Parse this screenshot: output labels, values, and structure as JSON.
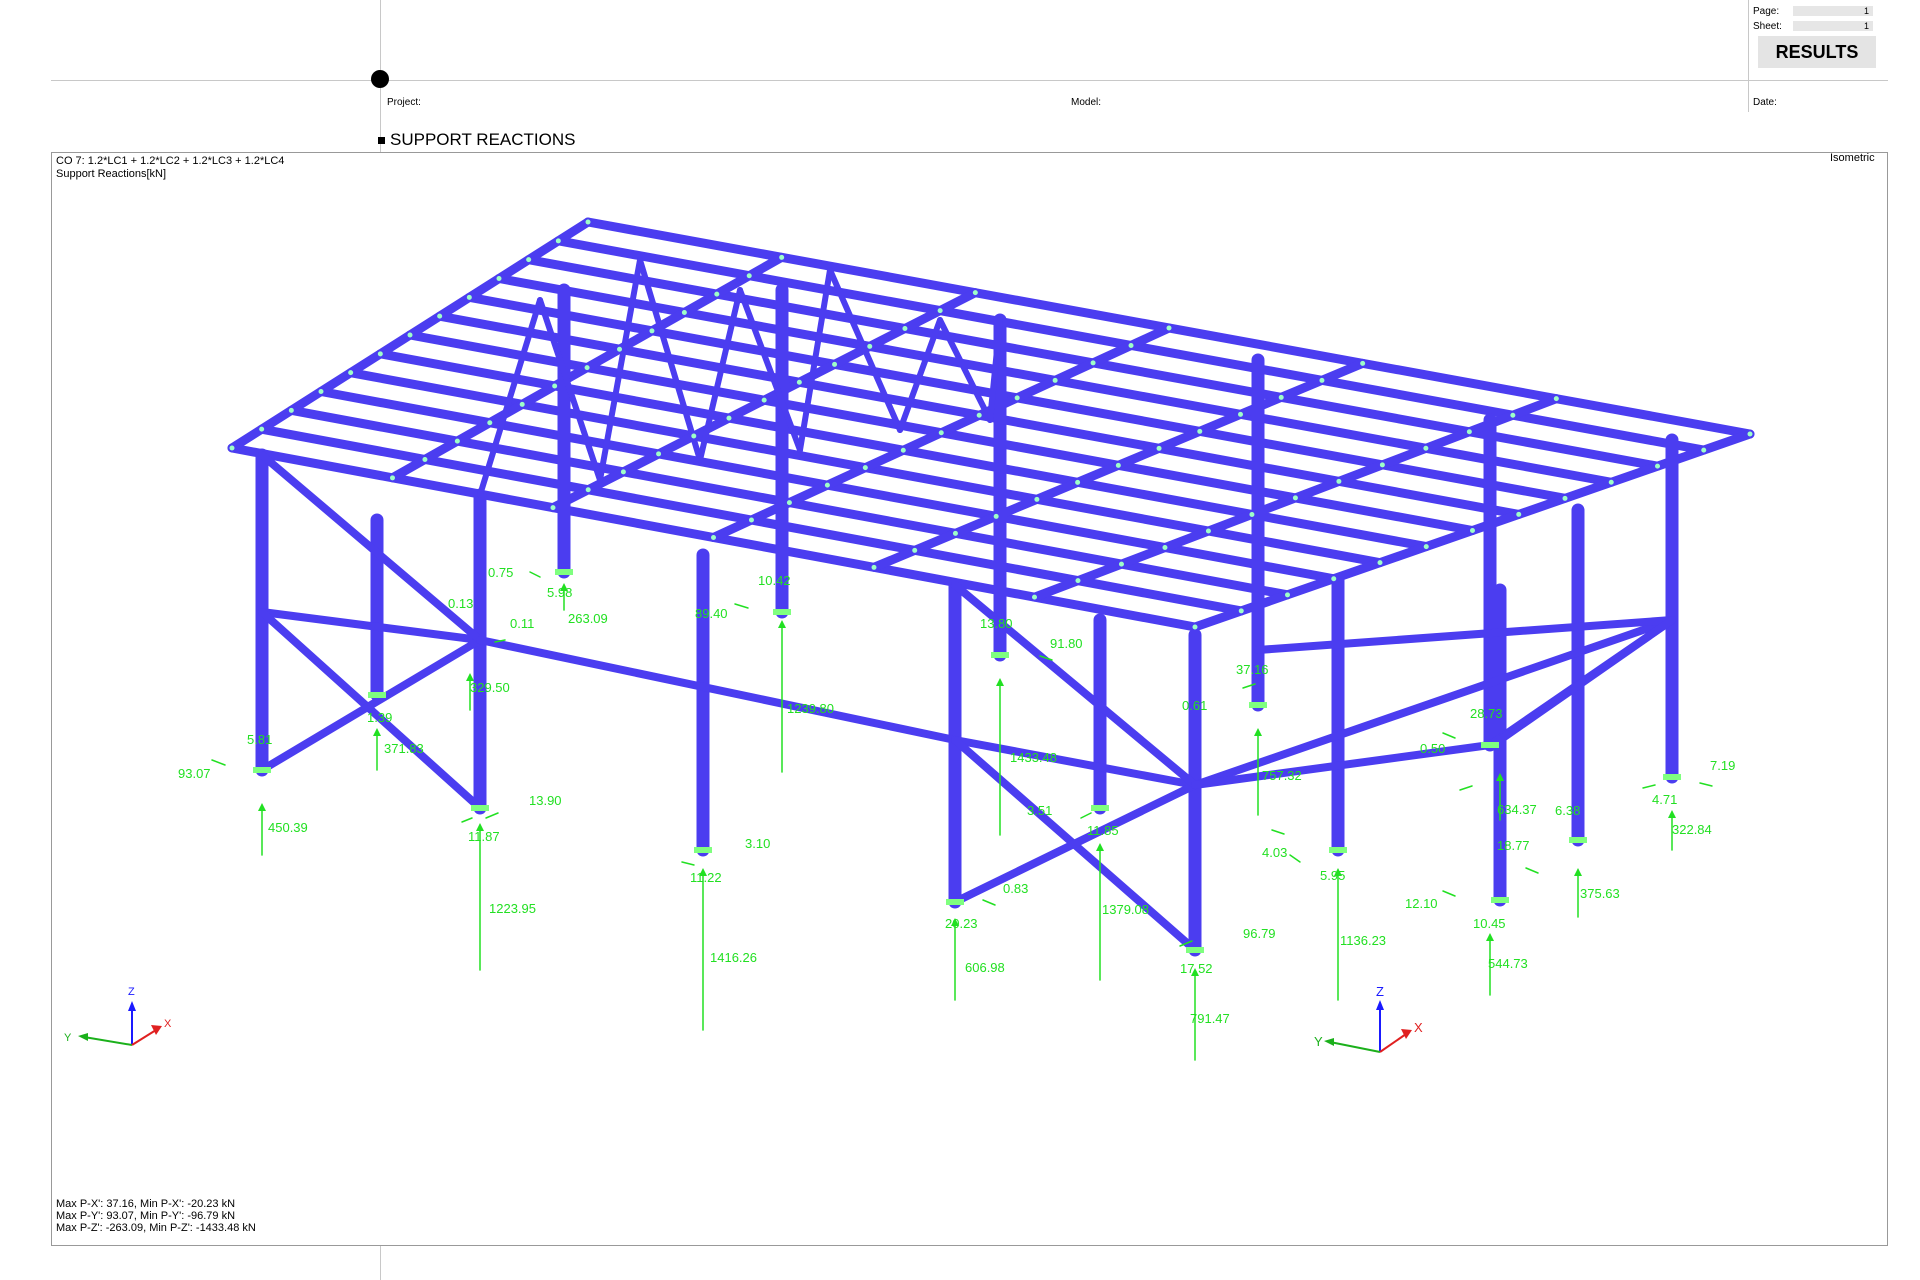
{
  "header": {
    "project_label": "Project:",
    "model_label": "Model:",
    "date_label": "Date:",
    "page_label": "Page:",
    "page_value": "1",
    "sheet_label": "Sheet:",
    "sheet_value": "1",
    "results_button": "RESULTS"
  },
  "section": {
    "title": "SUPPORT REACTIONS"
  },
  "view": {
    "load_combo": "CO 7: 1.2*LC1 + 1.2*LC2 + 1.2*LC3 + 1.2*LC4",
    "result_type": "Support Reactions[kN]",
    "projection": "Isometric"
  },
  "summary": [
    "Max P-X': 37.16, Min P-X': -20.23 kN",
    "Max P-Y': 93.07, Min P-Y': -96.79 kN",
    "Max P-Z': -263.09, Min P-Z': -1433.48 kN"
  ],
  "axis_labels": {
    "x": "X",
    "y": "Y",
    "z": "Z"
  },
  "colors": {
    "member": "#4b3df0",
    "member_edge": "#3529c8",
    "reaction": "#22e022",
    "support": "#7fff7f"
  },
  "reaction_labels": [
    "0.75",
    "5.98",
    "263.09",
    "0.13",
    "0.11",
    "329.50",
    "10.42",
    "89.40",
    "1239.80",
    "5.81",
    "93.07",
    "450.39",
    "1.39",
    "371.83",
    "13.90",
    "11.87",
    "1223.95",
    "3.10",
    "11.22",
    "1416.26",
    "13.80",
    "91.80",
    "1433.48",
    "37.16",
    "0.61",
    "757.32",
    "3.51",
    "11.85",
    "1379.08",
    "0.83",
    "20.23",
    "606.98",
    "96.79",
    "17.52",
    "791.47",
    "4.03",
    "5.95",
    "1136.23",
    "28.73",
    "0.50",
    "634.37",
    "18.77",
    "12.10",
    "10.45",
    "544.73",
    "6.38",
    "375.63",
    "7.19",
    "4.71",
    "322.84"
  ]
}
